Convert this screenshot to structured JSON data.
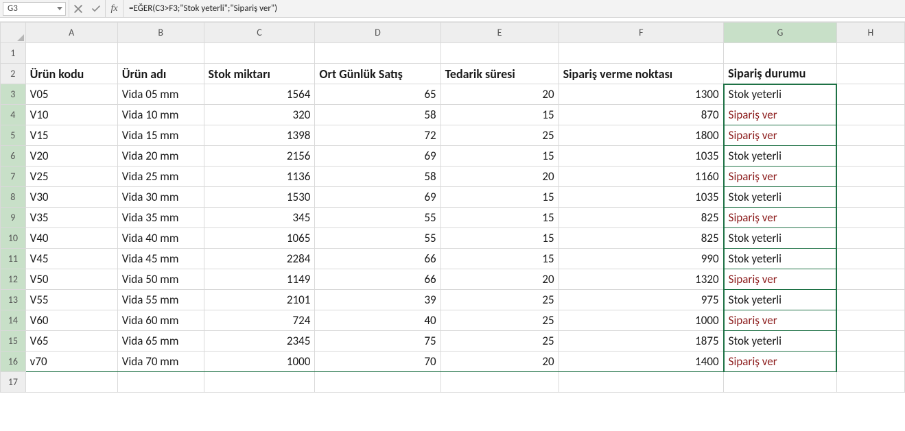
{
  "formula_bar": {
    "name_box": "G3",
    "fx_label": "fx",
    "formula": "=EĞER(C3>F3;\"Stok yeterli\";\"Sipariş ver\")"
  },
  "columns": [
    "A",
    "B",
    "C",
    "D",
    "E",
    "F",
    "G",
    "H"
  ],
  "row_numbers": [
    1,
    2,
    3,
    4,
    5,
    6,
    7,
    8,
    9,
    10,
    11,
    12,
    13,
    14,
    15,
    16,
    17
  ],
  "headers": {
    "A": "Ürün kodu",
    "B": "Ürün adı",
    "C": "Stok miktarı",
    "D": "Ort Günlük Satış",
    "E": "Tedarik süresi",
    "F": "Sipariş verme noktası",
    "G": "Sipariş durumu"
  },
  "status_text": {
    "ok": "Stok yeterli",
    "order": "Sipariş ver"
  },
  "colors": {
    "accent": "#1e7145",
    "status_ok_bg": "#c0c0c0",
    "status_warn_bg": "#c99294",
    "status_warn_fg": "#8b1a1a"
  },
  "rows": [
    {
      "code": "V05",
      "name": "Vida 05 mm",
      "stock": 1564,
      "daily": 65,
      "lead": 20,
      "reorder": 1300,
      "status": "ok"
    },
    {
      "code": "V10",
      "name": "Vida 10 mm",
      "stock": 320,
      "daily": 58,
      "lead": 15,
      "reorder": 870,
      "status": "order"
    },
    {
      "code": "V15",
      "name": "Vida 15 mm",
      "stock": 1398,
      "daily": 72,
      "lead": 25,
      "reorder": 1800,
      "status": "order"
    },
    {
      "code": "V20",
      "name": "Vida 20 mm",
      "stock": 2156,
      "daily": 69,
      "lead": 15,
      "reorder": 1035,
      "status": "ok"
    },
    {
      "code": "V25",
      "name": "Vida 25 mm",
      "stock": 1136,
      "daily": 58,
      "lead": 20,
      "reorder": 1160,
      "status": "order"
    },
    {
      "code": "V30",
      "name": "Vida 30 mm",
      "stock": 1530,
      "daily": 69,
      "lead": 15,
      "reorder": 1035,
      "status": "ok"
    },
    {
      "code": "V35",
      "name": "Vida 35 mm",
      "stock": 345,
      "daily": 55,
      "lead": 15,
      "reorder": 825,
      "status": "order"
    },
    {
      "code": "V40",
      "name": "Vida 40 mm",
      "stock": 1065,
      "daily": 55,
      "lead": 15,
      "reorder": 825,
      "status": "ok"
    },
    {
      "code": "V45",
      "name": "Vida 45 mm",
      "stock": 2284,
      "daily": 66,
      "lead": 15,
      "reorder": 990,
      "status": "ok"
    },
    {
      "code": "V50",
      "name": "Vida 50 mm",
      "stock": 1149,
      "daily": 66,
      "lead": 20,
      "reorder": 1320,
      "status": "order"
    },
    {
      "code": "V55",
      "name": "Vida 55 mm",
      "stock": 2101,
      "daily": 39,
      "lead": 25,
      "reorder": 975,
      "status": "ok"
    },
    {
      "code": "V60",
      "name": "Vida 60 mm",
      "stock": 724,
      "daily": 40,
      "lead": 25,
      "reorder": 1000,
      "status": "order"
    },
    {
      "code": "V65",
      "name": "Vida 65 mm",
      "stock": 2345,
      "daily": 75,
      "lead": 25,
      "reorder": 1875,
      "status": "ok"
    },
    {
      "code": "v70",
      "name": "Vida 70 mm",
      "stock": 1000,
      "daily": 70,
      "lead": 20,
      "reorder": 1400,
      "status": "order"
    }
  ]
}
